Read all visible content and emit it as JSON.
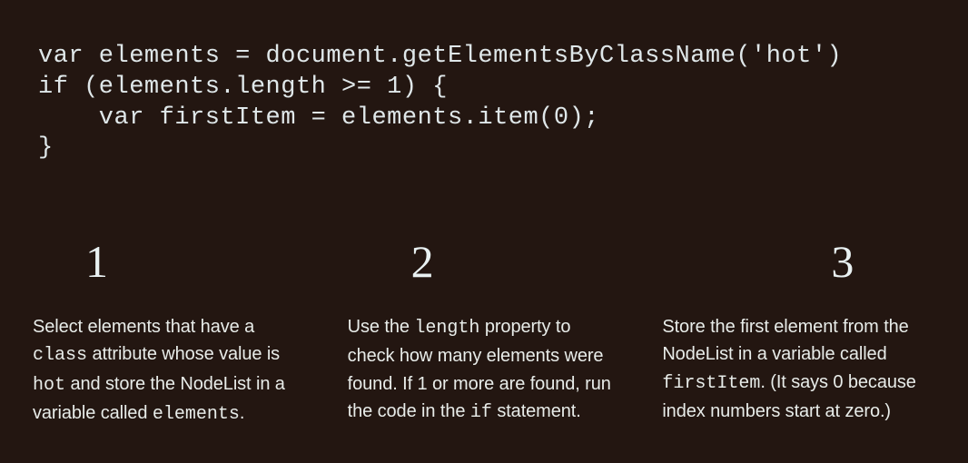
{
  "code": {
    "line1": "var elements = document.getElementsByClassName('hot')",
    "line2": "if (elements.length >= 1) {",
    "line3": "    var firstItem = elements.item(0);",
    "line4": "}"
  },
  "steps": [
    {
      "number": "1",
      "parts": [
        {
          "t": "Select elements that have a "
        },
        {
          "t": "class",
          "mono": true
        },
        {
          "t": " attribute whose value is "
        },
        {
          "t": "hot",
          "mono": true
        },
        {
          "t": " and store the NodeList in a variable called "
        },
        {
          "t": "elements",
          "mono": true
        },
        {
          "t": "."
        }
      ]
    },
    {
      "number": "2",
      "parts": [
        {
          "t": "Use the "
        },
        {
          "t": "length",
          "mono": true
        },
        {
          "t": " property to check how many elements were found. If 1 or more are found, run the code in the "
        },
        {
          "t": "if",
          "mono": true
        },
        {
          "t": " statement."
        }
      ]
    },
    {
      "number": "3",
      "parts": [
        {
          "t": "Store the first element from the NodeList in a variable called "
        },
        {
          "t": "firstItem",
          "mono": true
        },
        {
          "t": ". (It says 0 because index numbers start at zero.)"
        }
      ]
    }
  ]
}
